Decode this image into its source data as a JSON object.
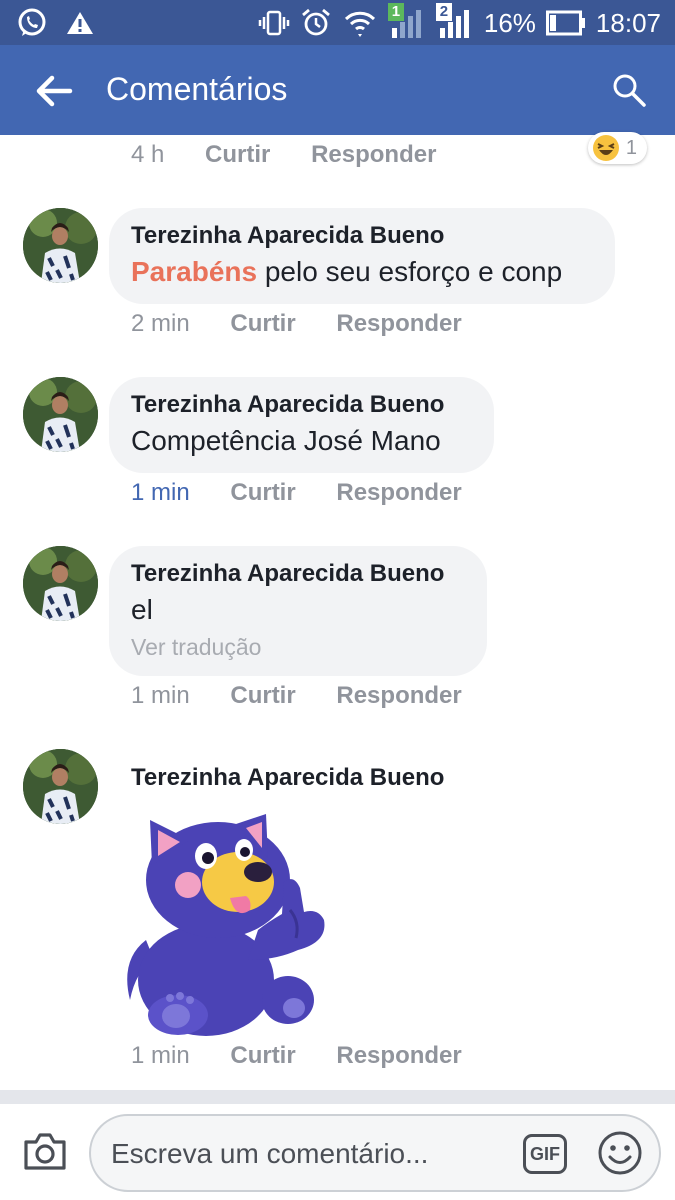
{
  "status_bar": {
    "battery_percent": "16%",
    "time": "18:07",
    "sim1_badge": "1",
    "sim2_badge": "2",
    "icons": [
      "whatsapp-icon",
      "alert-icon",
      "vibrate-icon",
      "alarm-icon",
      "wifi-icon",
      "signal-icon",
      "battery-icon"
    ]
  },
  "app_bar": {
    "title": "Comentários",
    "back_icon": "back-arrow-icon",
    "search_icon": "search-icon"
  },
  "top_partial": {
    "time": "4 h",
    "like": "Curtir",
    "reply": "Responder",
    "reaction_count": "1",
    "reaction_icon": "haha-emoji-icon"
  },
  "comments": [
    {
      "author": "Terezinha Aparecida Bueno",
      "mention": "Parabéns",
      "text": " pelo seu esforço e conp",
      "time": "2 min",
      "like": "Curtir",
      "reply": "Responder"
    },
    {
      "author": "Terezinha Aparecida Bueno",
      "text": "Competência José Mano",
      "time": "1 min",
      "like": "Curtir",
      "reply": "Responder"
    },
    {
      "author": "Terezinha Aparecida Bueno",
      "text": "el",
      "translate": "Ver tradução",
      "time": "1 min",
      "like": "Curtir",
      "reply": "Responder"
    },
    {
      "author": "Terezinha Aparecida Bueno",
      "sticker": "purple-dog-thumbs-up-sticker",
      "time": "1 min",
      "like": "Curtir",
      "reply": "Responder"
    }
  ],
  "composer": {
    "placeholder": "Escreva um comentário...",
    "gif_label": "GIF",
    "camera_icon": "camera-icon",
    "emoji_icon": "smiley-icon"
  },
  "colors": {
    "status_bar": "#3b5795",
    "app_bar": "#4267b2",
    "bubble": "#f2f3f5",
    "mention": "#e9725a",
    "meta": "#90949c",
    "recent_time": "#4267b2"
  }
}
